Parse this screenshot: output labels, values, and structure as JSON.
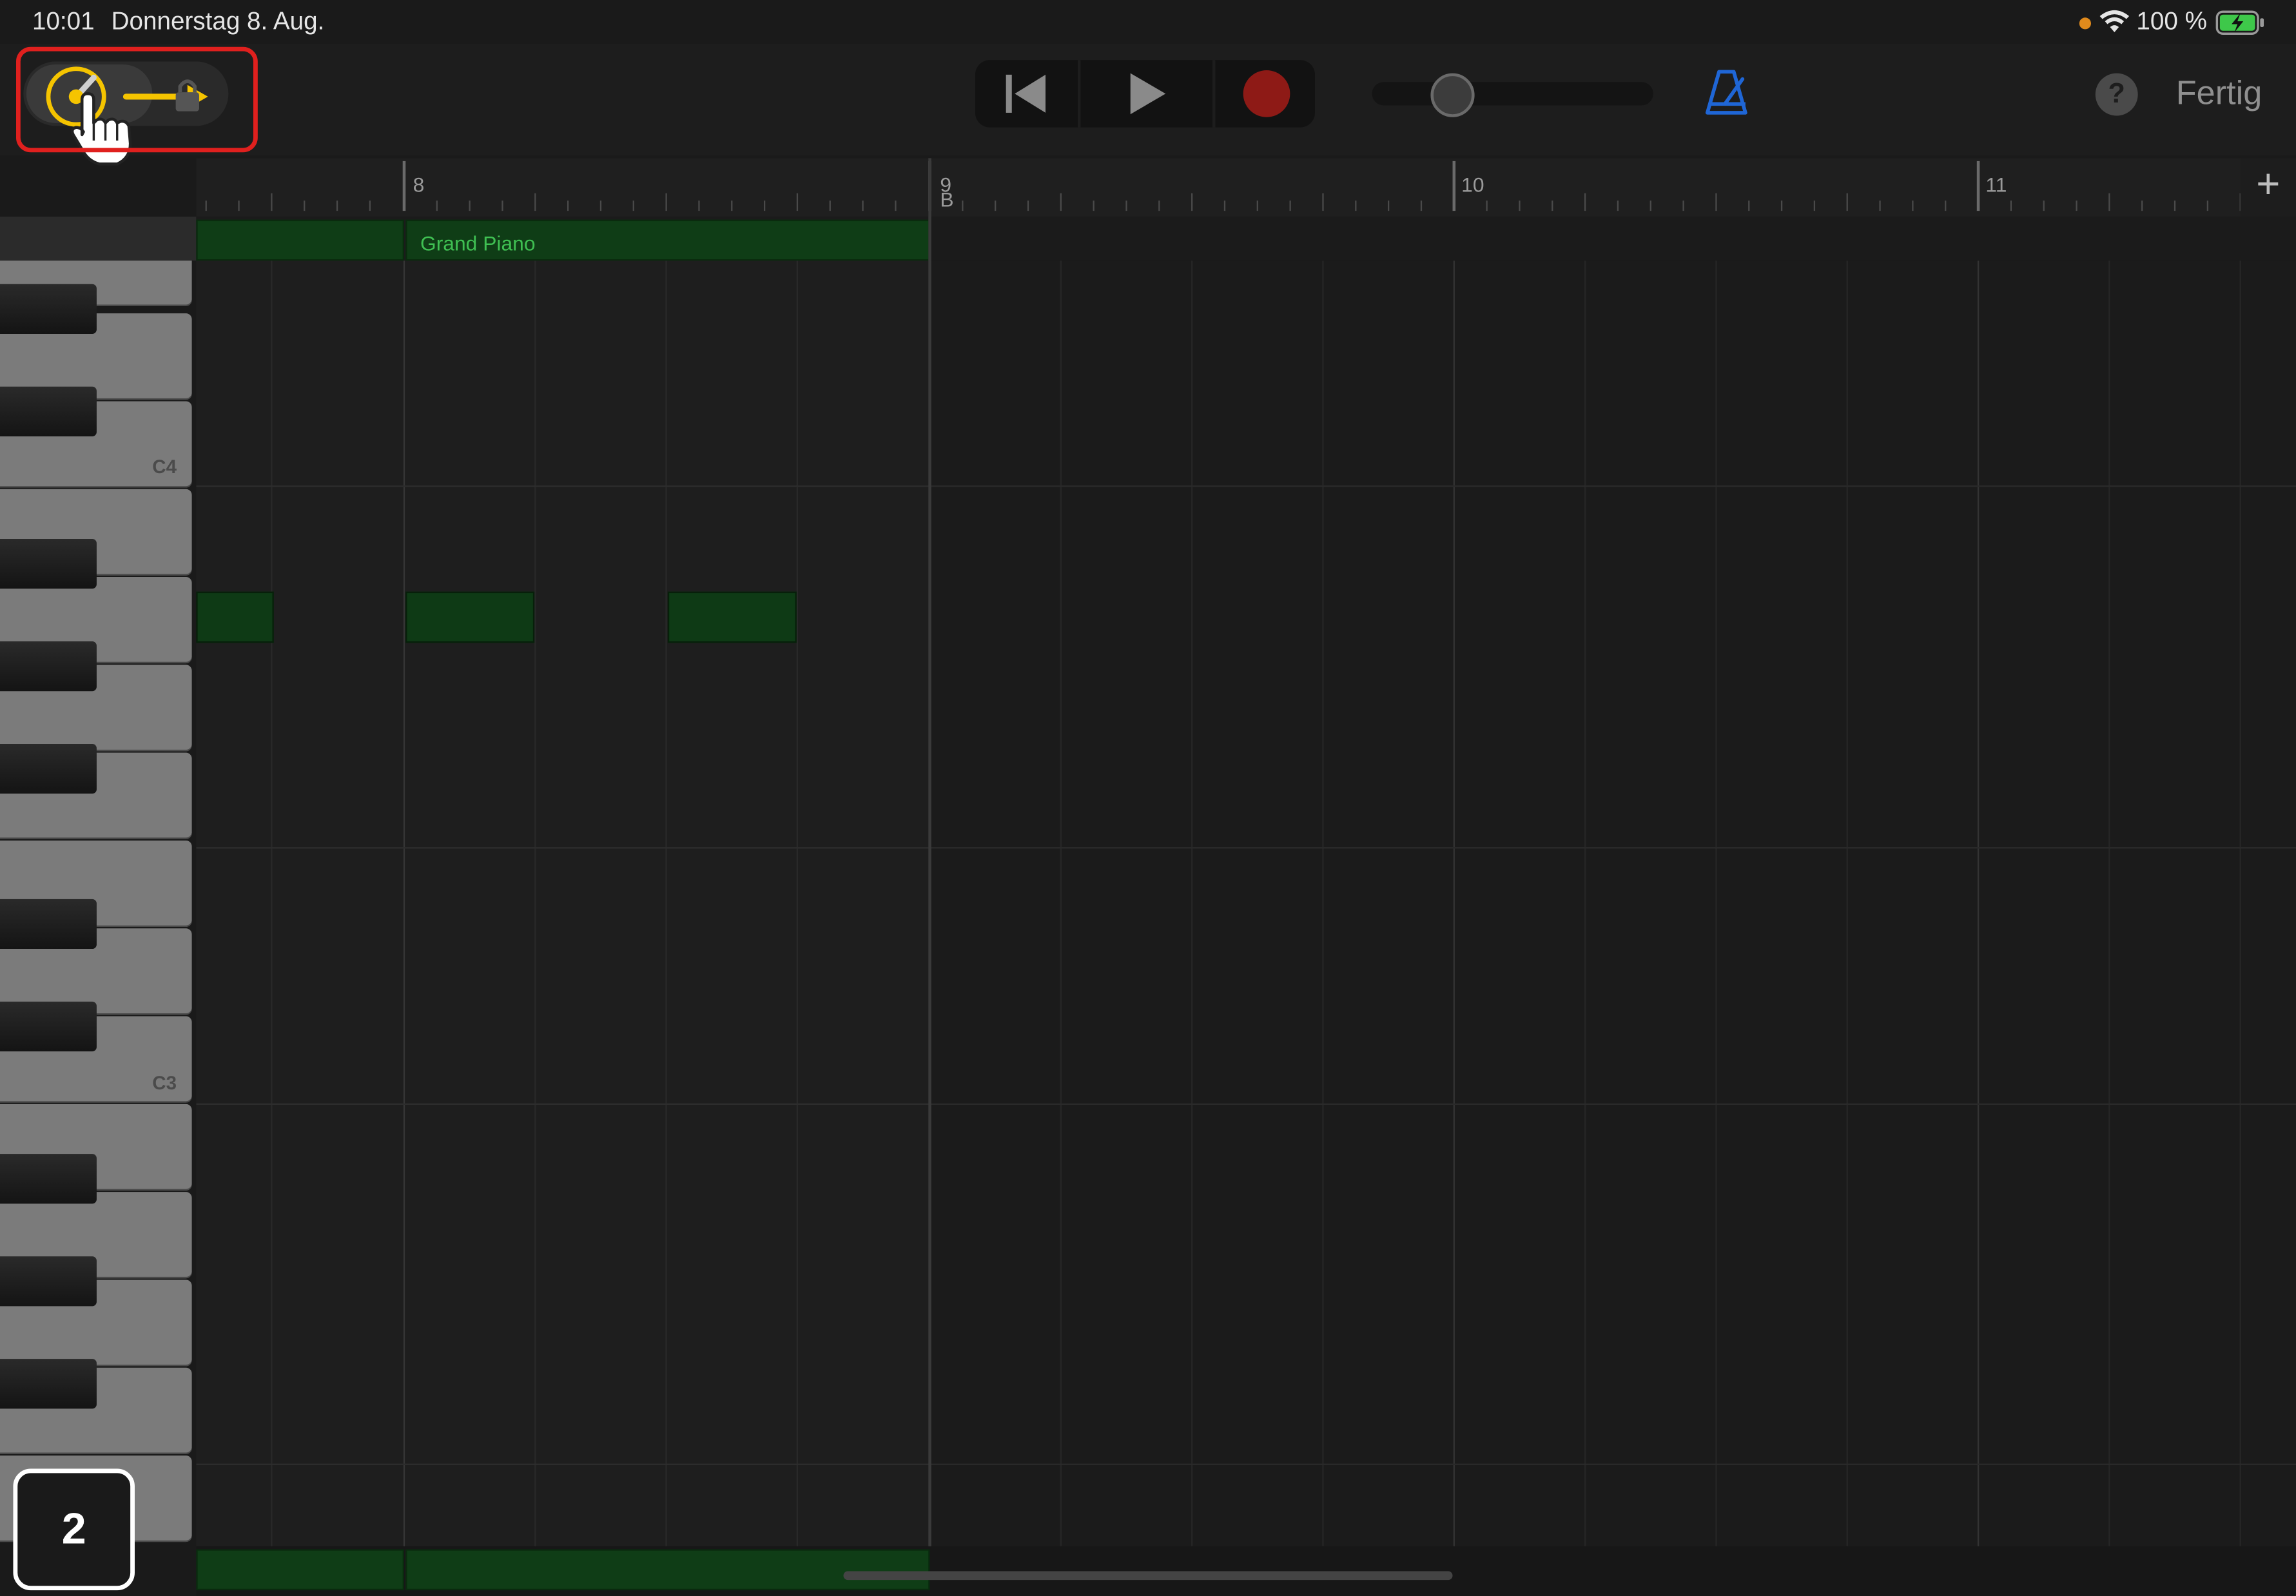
{
  "status_bar": {
    "time": "10:01",
    "date": "Donnerstag 8. Aug.",
    "battery": "100 %",
    "icons": [
      "recording-dot-icon",
      "wifi-icon",
      "battery-charging-icon"
    ]
  },
  "toolbar": {
    "left_icons": [
      "pencil-knob-icon",
      "tap-hand-icon",
      "arrow-right-icon",
      "lock-icon"
    ],
    "transport_icons": [
      "go-to-start-icon",
      "play-icon",
      "record-icon"
    ],
    "metronome_icon": "metronome-icon",
    "help_label": "?",
    "done_label": "Fertig",
    "colors": {
      "highlight": "#e0201e",
      "accent_yellow": "#f5c400",
      "record": "#8e1a16",
      "metronome": "#1f66d6"
    }
  },
  "ruler": {
    "bars": [
      "8",
      "9",
      "10",
      "11"
    ],
    "marker_b": "B",
    "add_label": "+"
  },
  "region": {
    "name": "Grand Piano",
    "color": "#0f3d16"
  },
  "piano": {
    "labels": [
      "C4",
      "C3"
    ]
  },
  "step_badge": "2"
}
